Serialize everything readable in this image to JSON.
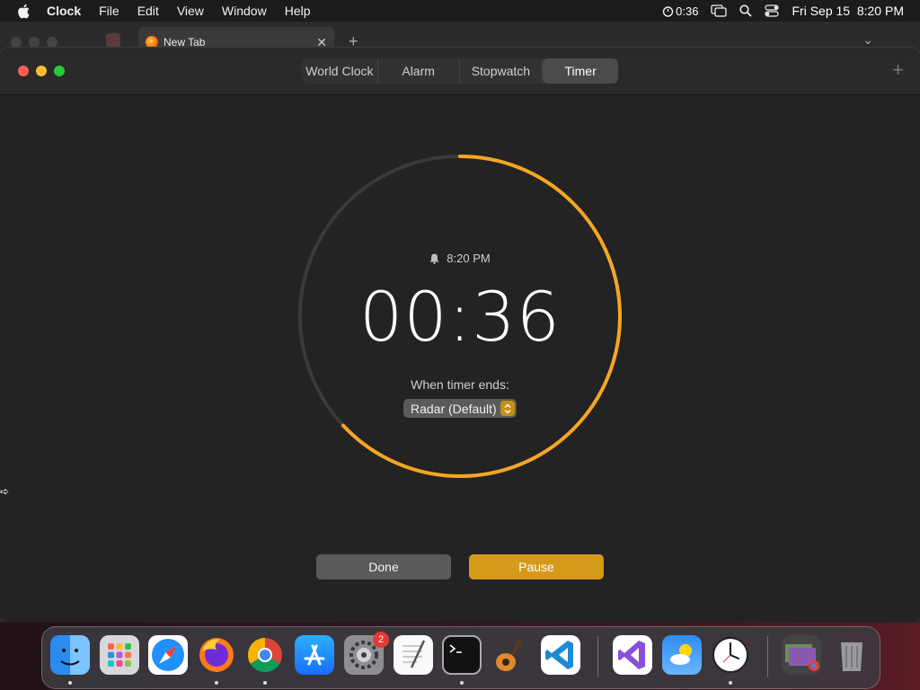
{
  "menubar": {
    "app_name": "Clock",
    "items": [
      "File",
      "Edit",
      "View",
      "Window",
      "Help"
    ],
    "timer_status": "0:36",
    "datetime": "Fri Sep 15  8:20 PM"
  },
  "browser": {
    "tab_title": "New Tab"
  },
  "tabs": [
    {
      "label": "World Clock",
      "active": false
    },
    {
      "label": "Alarm",
      "active": false
    },
    {
      "label": "Stopwatch",
      "active": false
    },
    {
      "label": "Timer",
      "active": true
    }
  ],
  "timer": {
    "alarm_time": "8:20 PM",
    "remaining": "00:36",
    "progress_remaining_fraction": 0.63,
    "when_ends_label": "When timer ends:",
    "sound": "Radar (Default)",
    "done_label": "Done",
    "pause_label": "Pause",
    "accent_color": "#f5a623"
  },
  "dock": {
    "apps": [
      "finder",
      "launchpad",
      "safari",
      "firefox",
      "chrome",
      "app-store",
      "system-settings",
      "textedit",
      "terminal",
      "garageband",
      "vscode",
      "visual-studio",
      "weather",
      "clock",
      "downloads",
      "trash"
    ],
    "settings_badge": "2"
  }
}
